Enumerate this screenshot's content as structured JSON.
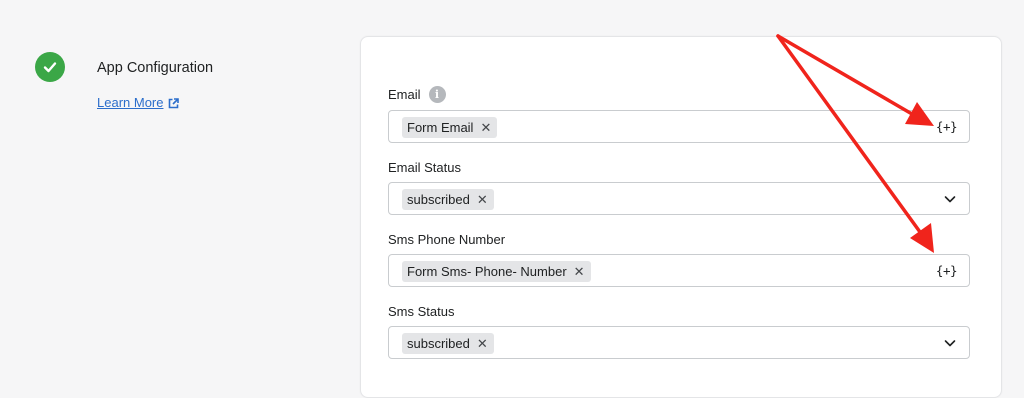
{
  "step": {
    "title": "App Configuration",
    "learn_more": "Learn More",
    "status_color": "#3ba747",
    "check_icon": "checkmark-icon",
    "link_icon": "external-link-icon"
  },
  "fields": [
    {
      "label": "Email",
      "has_info": true,
      "chip": "Form Email",
      "control": "variable-insert",
      "control_text": "{+}"
    },
    {
      "label": "Email Status",
      "has_info": false,
      "chip": "subscribed",
      "control": "dropdown"
    },
    {
      "label": "Sms Phone Number",
      "has_info": false,
      "chip": "Form Sms- Phone- Number",
      "control": "variable-insert",
      "control_text": "{+}"
    },
    {
      "label": "Sms Status",
      "has_info": false,
      "chip": "subscribed",
      "control": "dropdown"
    }
  ],
  "chip_remove_glyph": "✕",
  "info_glyph": "i",
  "annotation_color": "#f0241c"
}
